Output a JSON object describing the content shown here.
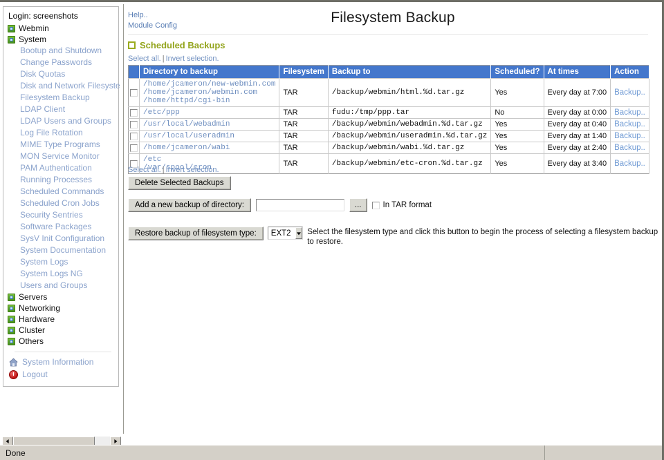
{
  "window": {
    "status_text": "Done"
  },
  "sidebar": {
    "login_label": "Login: screenshots",
    "categories": [
      {
        "label": "Webmin",
        "icon": "module-icon"
      },
      {
        "label": "System",
        "icon": "module-icon"
      }
    ],
    "system_items": [
      {
        "label": "Bootup and Shutdown"
      },
      {
        "label": "Change Passwords"
      },
      {
        "label": "Disk Quotas"
      },
      {
        "label": "Disk and Network Filesystems"
      },
      {
        "label": "Filesystem Backup"
      },
      {
        "label": "LDAP Client"
      },
      {
        "label": "LDAP Users and Groups"
      },
      {
        "label": "Log File Rotation"
      },
      {
        "label": "MIME Type Programs"
      },
      {
        "label": "MON Service Monitor"
      },
      {
        "label": "PAM Authentication"
      },
      {
        "label": "Running Processes"
      },
      {
        "label": "Scheduled Commands"
      },
      {
        "label": "Scheduled Cron Jobs"
      },
      {
        "label": "Security Sentries"
      },
      {
        "label": "Software Packages"
      },
      {
        "label": "SysV Init Configuration"
      },
      {
        "label": "System Documentation"
      },
      {
        "label": "System Logs"
      },
      {
        "label": "System Logs NG"
      },
      {
        "label": "Users and Groups"
      }
    ],
    "trailing_categories": [
      {
        "label": "Servers",
        "icon": "module-icon"
      },
      {
        "label": "Networking",
        "icon": "module-icon"
      },
      {
        "label": "Hardware",
        "icon": "module-icon"
      },
      {
        "label": "Cluster",
        "icon": "module-icon"
      },
      {
        "label": "Others",
        "icon": "module-icon"
      }
    ],
    "footer_items": [
      {
        "label": "System Information",
        "icon": "home-icon"
      },
      {
        "label": "Logout",
        "icon": "power-icon"
      }
    ]
  },
  "header": {
    "help_link": "Help..",
    "module_config_link": "Module Config",
    "title": "Filesystem Backup"
  },
  "section": {
    "title": "Scheduled Backups",
    "select_all": "Select all.",
    "invert_selection": "Invert selection.",
    "separator": "|"
  },
  "table": {
    "columns": [
      "Directory to backup",
      "Filesystem",
      "Backup to",
      "Scheduled?",
      "At times",
      "Action"
    ],
    "rows": [
      {
        "directories": [
          "/home/jcameron/new-webmin.com",
          "/home/jcameron/webmin.com",
          "/home/httpd/cgi-bin"
        ],
        "filesystem": "TAR",
        "backup_to": "/backup/webmin/html.%d.tar.gz",
        "scheduled": "Yes",
        "at_times": "Every day at 7:00",
        "action": "Backup.."
      },
      {
        "directories": [
          "/etc/ppp"
        ],
        "filesystem": "TAR",
        "backup_to": "fudu:/tmp/ppp.tar",
        "scheduled": "No",
        "at_times": "Every day at 0:00",
        "action": "Backup.."
      },
      {
        "directories": [
          "/usr/local/webadmin"
        ],
        "filesystem": "TAR",
        "backup_to": "/backup/webmin/webadmin.%d.tar.gz",
        "scheduled": "Yes",
        "at_times": "Every day at 0:40",
        "action": "Backup.."
      },
      {
        "directories": [
          "/usr/local/useradmin"
        ],
        "filesystem": "TAR",
        "backup_to": "/backup/webmin/useradmin.%d.tar.gz",
        "scheduled": "Yes",
        "at_times": "Every day at 1:40",
        "action": "Backup.."
      },
      {
        "directories": [
          "/home/jcameron/wabi"
        ],
        "filesystem": "TAR",
        "backup_to": "/backup/webmin/wabi.%d.tar.gz",
        "scheduled": "Yes",
        "at_times": "Every day at 2:40",
        "action": "Backup.."
      },
      {
        "directories": [
          "/etc",
          "/var/spool/cron"
        ],
        "filesystem": "TAR",
        "backup_to": "/backup/webmin/etc-cron.%d.tar.gz",
        "scheduled": "Yes",
        "at_times": "Every day at 3:40",
        "action": "Backup.."
      }
    ]
  },
  "controls": {
    "delete_button": "Delete Selected Backups",
    "add_button": "Add a new backup of directory:",
    "add_input_value": "",
    "file_chooser_button": "...",
    "tar_format_label": "In TAR format",
    "restore_button": "Restore backup of filesystem type:",
    "restore_select_value": "EXT2",
    "restore_description": "Select the filesystem type and click this button to begin the process of selecting a filesystem backup to restore."
  },
  "colors": {
    "table_header_blue": "#4477cc",
    "section_olive": "#93a41c",
    "link_blue": "#6f8fc0"
  }
}
